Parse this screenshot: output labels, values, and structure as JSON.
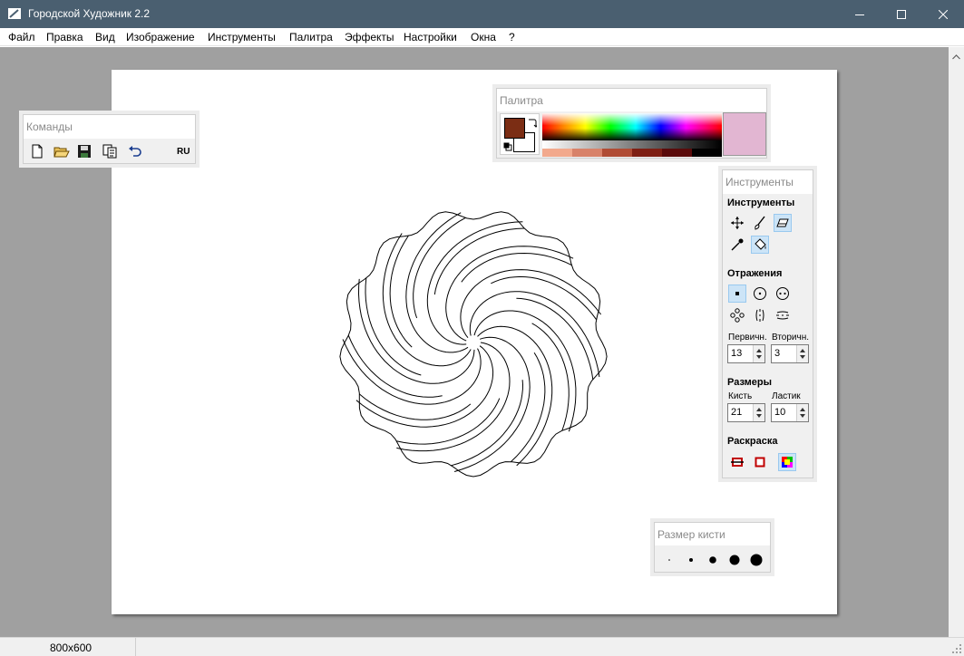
{
  "window": {
    "title": "Городской Художник 2.2"
  },
  "menu": [
    "Файл",
    "Правка",
    "Вид",
    "Изображение",
    "Инструменты",
    "Палитра",
    "Эффекты",
    "Настройки",
    "Окна",
    "?"
  ],
  "commands_panel": {
    "title": "Команды",
    "lang": "RU",
    "buttons": [
      "new-file-icon",
      "open-folder-icon",
      "save-icon",
      "copy-icon",
      "undo-icon"
    ]
  },
  "palette_panel": {
    "title": "Палитра",
    "primary_color": "#7b2d14",
    "secondary_color": "#ffffff",
    "preview_color": "#e2b6d2",
    "swatches": [
      "#f2a98d",
      "#d8826a",
      "#b04c35",
      "#7e1f14",
      "#5a0b0b",
      "#000000"
    ]
  },
  "tools_panel": {
    "title": "Инструменты",
    "tools_section": "Инструменты",
    "tools": [
      "move-icon",
      "brush-icon",
      "eraser-icon",
      "eyedropper-icon",
      "fill-bucket-icon"
    ],
    "active_tool": "eraser-icon",
    "reflections_section": "Отражения",
    "reflections": [
      "single-point-icon",
      "circle-symmetry-icon",
      "double-symmetry-icon",
      "flower-symmetry-icon",
      "vertical-mirror-icon",
      "horizontal-mirror-icon"
    ],
    "active_reflection": "single-point-icon",
    "primary_label": "Первичн.",
    "secondary_label": "Вторичн.",
    "primary_value": "13",
    "secondary_value": "3",
    "sizes_section": "Размеры",
    "brush_label": "Кисть",
    "eraser_label": "Ластик",
    "brush_value": "21",
    "eraser_value": "10",
    "coloring_section": "Раскраска",
    "coloring": [
      "fill-outline-icon",
      "outline-icon",
      "multicolor-icon"
    ],
    "active_coloring": "multicolor-icon"
  },
  "brush_size_panel": {
    "title": "Размер кисти",
    "sizes": [
      "tiny",
      "small",
      "medium",
      "large",
      "xlarge"
    ]
  },
  "status": {
    "canvas_size": "800x600"
  }
}
